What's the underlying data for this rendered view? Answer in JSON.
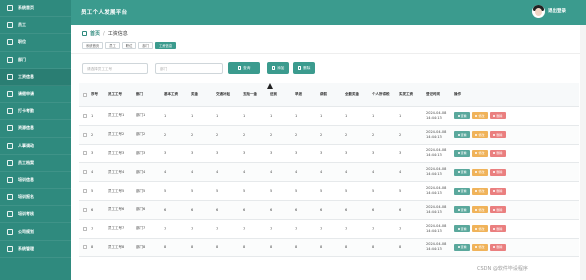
{
  "app": {
    "title": "员工个人发展平台",
    "logout_label": "退出登录"
  },
  "sidebar": {
    "items": [
      {
        "label": "系统首页"
      },
      {
        "label": "员工"
      },
      {
        "label": "职位"
      },
      {
        "label": "部门"
      },
      {
        "label": "工资信息"
      },
      {
        "label": "请假申请"
      },
      {
        "label": "打卡考勤"
      },
      {
        "label": "资源信息"
      },
      {
        "label": "人事调动"
      },
      {
        "label": "员工档案"
      },
      {
        "label": "培训信息"
      },
      {
        "label": "培训报名"
      },
      {
        "label": "培训考核"
      },
      {
        "label": "公司规划"
      },
      {
        "label": "系统管理"
      }
    ]
  },
  "breadcrumb": {
    "home": "首页",
    "separator": "/",
    "current": "工资信息"
  },
  "tags": [
    "系统首页",
    "员工",
    "职位",
    "部门",
    "工资信息"
  ],
  "search": {
    "name_placeholder": "请选择员工工号",
    "dept_placeholder": "部门"
  },
  "toolbar": {
    "query_label": "查询",
    "add_label": "添加",
    "delete_label": "删除"
  },
  "table": {
    "headers": [
      "序号",
      "员工工号",
      "部门",
      "基本工资",
      "奖金",
      "交通补贴",
      "五险一金",
      "迟到",
      "早退",
      "病假",
      "全勤奖金",
      "个人所得税",
      "实发工资",
      "登记时间",
      "操作"
    ],
    "rows": [
      {
        "no": "1",
        "id": "员工工号1",
        "dept": "部门1",
        "v": [
          "1",
          "1",
          "1",
          "1",
          "1",
          "1",
          "1",
          "1",
          "1",
          "1"
        ],
        "date": "2024-04-08",
        "time": "14:44:13"
      },
      {
        "no": "2",
        "id": "员工工号2",
        "dept": "部门2",
        "v": [
          "2",
          "2",
          "2",
          "2",
          "2",
          "2",
          "2",
          "2",
          "2",
          "2"
        ],
        "date": "2024-04-08",
        "time": "14:44:13"
      },
      {
        "no": "3",
        "id": "员工工号3",
        "dept": "部门3",
        "v": [
          "3",
          "3",
          "3",
          "3",
          "3",
          "3",
          "3",
          "3",
          "3",
          "3"
        ],
        "date": "2024-04-08",
        "time": "14:44:13"
      },
      {
        "no": "4",
        "id": "员工工号4",
        "dept": "部门4",
        "v": [
          "4",
          "4",
          "4",
          "4",
          "4",
          "4",
          "4",
          "4",
          "4",
          "4"
        ],
        "date": "2024-04-08",
        "time": "14:44:13"
      },
      {
        "no": "5",
        "id": "员工工号5",
        "dept": "部门5",
        "v": [
          "5",
          "5",
          "5",
          "5",
          "5",
          "5",
          "5",
          "5",
          "5",
          "5"
        ],
        "date": "2024-04-08",
        "time": "14:44:13"
      },
      {
        "no": "6",
        "id": "员工工号6",
        "dept": "部门6",
        "v": [
          "6",
          "6",
          "6",
          "6",
          "6",
          "6",
          "6",
          "6",
          "6",
          "6"
        ],
        "date": "2024-04-08",
        "time": "14:44:13"
      },
      {
        "no": "7",
        "id": "员工工号7",
        "dept": "部门7",
        "v": [
          "7",
          "7",
          "7",
          "7",
          "7",
          "7",
          "7",
          "7",
          "7",
          "7"
        ],
        "date": "2024-04-08",
        "time": "14:44:13"
      },
      {
        "no": "8",
        "id": "员工工号8",
        "dept": "部门8",
        "v": [
          "8",
          "8",
          "8",
          "8",
          "8",
          "8",
          "8",
          "8",
          "8",
          "8"
        ],
        "date": "2024-04-08",
        "time": "14:44:13"
      }
    ],
    "ops": {
      "view": "查看",
      "edit": "修改",
      "delete": "删除"
    }
  },
  "watermark": "CSDN @软件毕设程序",
  "colors": {
    "primary": "#3b9b8e",
    "sidebar": "#2f8a7e",
    "edit": "#f0b35a",
    "delete": "#ea7f7f"
  }
}
